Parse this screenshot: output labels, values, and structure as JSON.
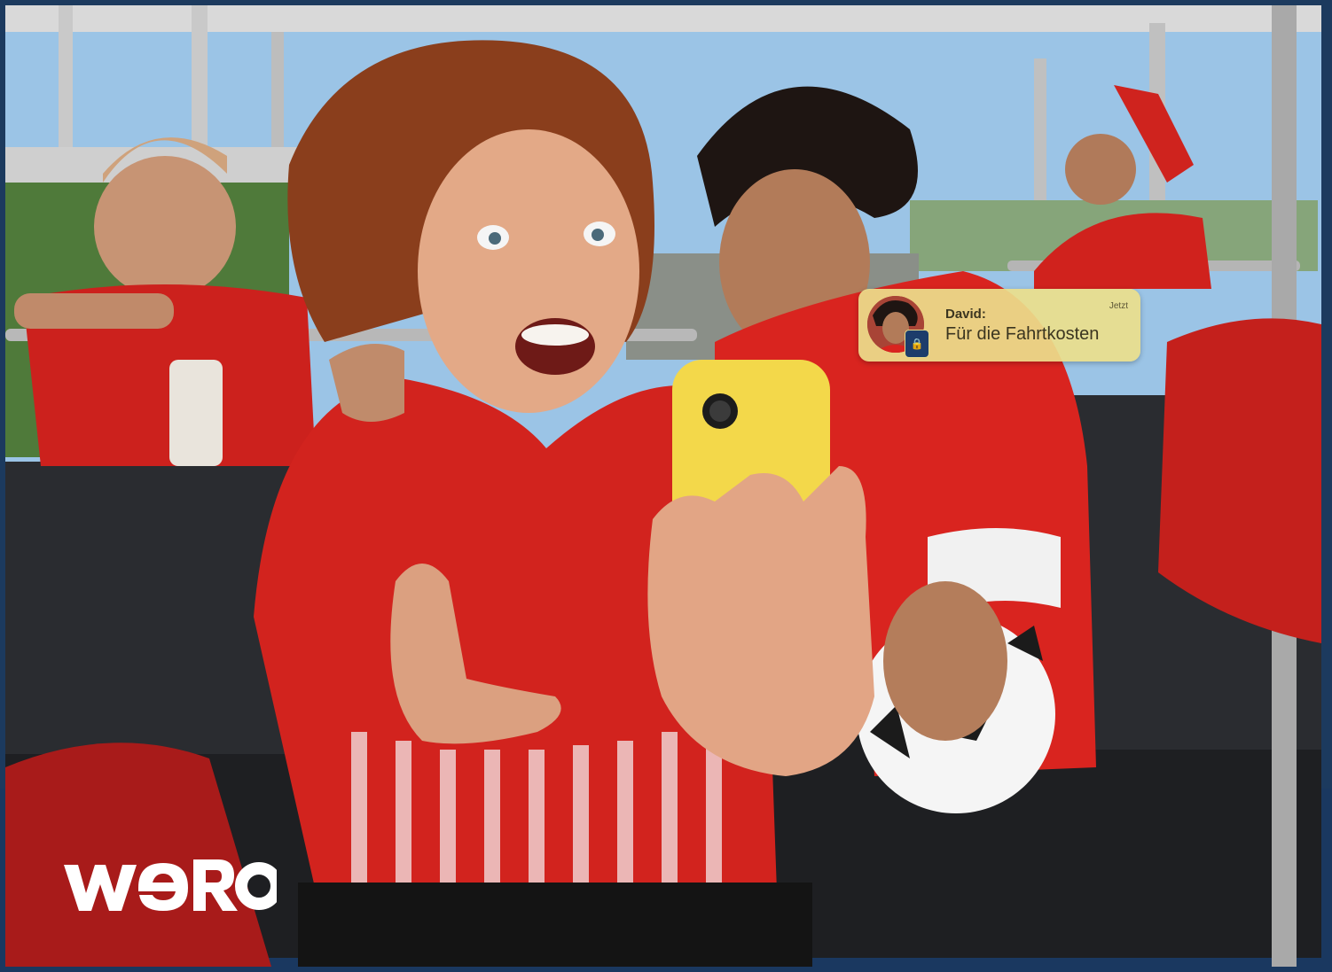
{
  "notification": {
    "sender": "David:",
    "time": "Jetzt",
    "message": "Für die Fahrtkosten"
  },
  "brand": {
    "logo_text": "wero"
  },
  "colors": {
    "jersey_red": "#d2231e",
    "phone_yellow": "#f3d84a",
    "brand_navy": "#1a3860",
    "notification_bg": "#ecde8c"
  }
}
